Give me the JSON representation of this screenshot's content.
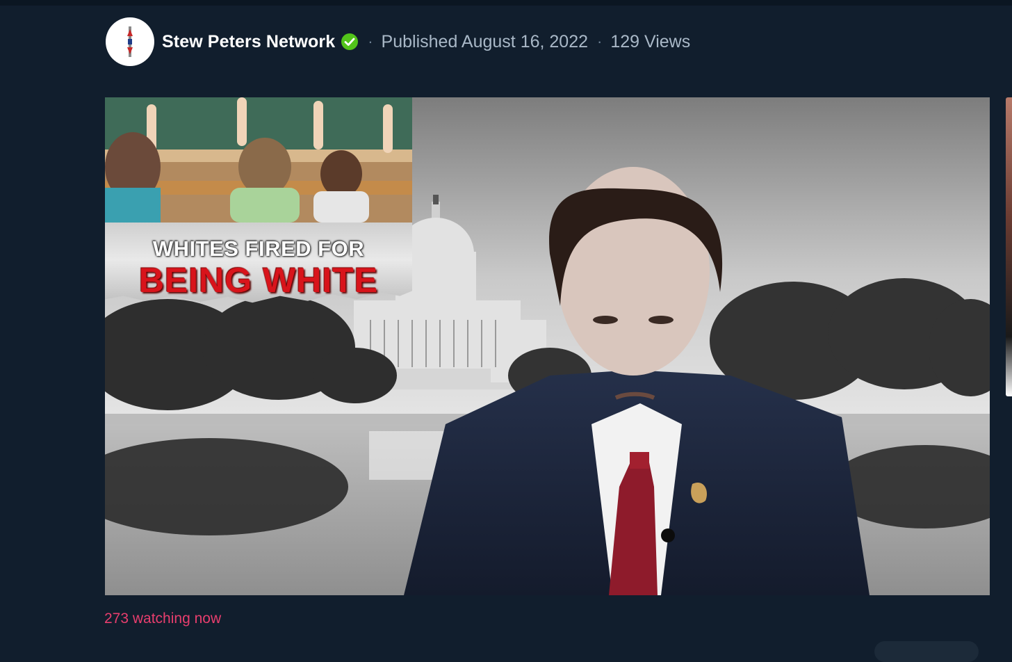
{
  "channel": {
    "name": "Stew Peters Network",
    "avatar_icon": "channel-logo-icon",
    "verified_icon": "verified-check-icon",
    "verified_color": "#52c41a"
  },
  "video": {
    "published": "Published August 16, 2022",
    "views": "129 Views",
    "separator": "·",
    "banner_line1": "WHITES FIRED FOR",
    "banner_line2": "BEING WHITE",
    "watching": "273 watching now"
  },
  "colors": {
    "background": "#111e2d",
    "meta_text": "#a9b8c7",
    "watching_text": "#e83e6e",
    "banner_red": "#d8141b"
  }
}
